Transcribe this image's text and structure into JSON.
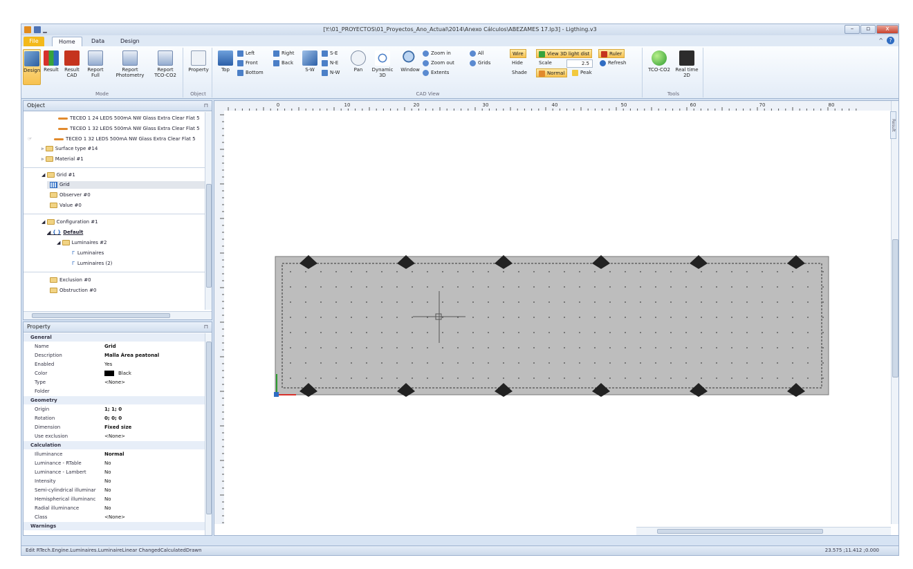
{
  "window": {
    "title": "[Y:\\01_PROYECTOS\\01_Proyectos_Ano_Actual\\2014\\Anexo Cálculos\\ABEZAMES 17.lp3] - Ligthing.v3",
    "controls": [
      "–",
      "▫",
      "x"
    ]
  },
  "tabs": [
    {
      "label": "File"
    },
    {
      "label": "Home"
    },
    {
      "label": "Data"
    },
    {
      "label": "Design"
    }
  ],
  "ribbon": {
    "mode": {
      "group_label": "Mode",
      "buttons": [
        {
          "label": "Design",
          "icon": "design-icon"
        },
        {
          "label": "Result",
          "icon": "bar-chart-icon"
        },
        {
          "label": "Result CAD",
          "icon": "cad-icon"
        },
        {
          "label": "Report Full",
          "icon": "report-icon"
        },
        {
          "label": "Report Photometry",
          "icon": "report-icon"
        },
        {
          "label": "Report TCO-CO2",
          "icon": "report-icon"
        }
      ]
    },
    "object": {
      "group_label": "Object",
      "button": "Property"
    },
    "cadview": {
      "group_label": "CAD View",
      "top": "Top",
      "left": "Left",
      "right": "Right",
      "front": "Front",
      "back": "Back",
      "bottom": "Bottom",
      "sw": "S-W",
      "se": "S-E",
      "ne": "N-E",
      "nw": "N-W",
      "pan": "Pan",
      "dynamic": "Dynamic 3D",
      "window": "Window",
      "zoom_in": "Zoom in",
      "zoom_out": "Zoom out",
      "extents": "Extents",
      "all": "All",
      "grids": "Grids",
      "wire": "Wire",
      "hide": "Hide",
      "shade": "Shade",
      "view3d": "View 3D light dist",
      "scale_label": "Scale",
      "scale_value": "2.5",
      "normal": "Normal",
      "peak": "Peak",
      "ruler": "Ruler",
      "refresh": "Refresh"
    },
    "tools": {
      "group_label": "Tools",
      "tco": "TCO-CO2",
      "realtime": "Real time 2D"
    }
  },
  "object_panel": {
    "title": "Object",
    "nodes": [
      {
        "label": "TECEO 1 24 LEDS 500mA NW Glass Extra Clear Flat 5",
        "kind": "lum"
      },
      {
        "label": "TECEO 1 32 LEDS 500mA NW Glass Extra Clear Flat 5",
        "kind": "lum"
      },
      {
        "label": "TECEO 1 32 LEDS 500mA NW Glass Extra Clear Flat 5",
        "kind": "lum"
      },
      {
        "label": "Surface type #14",
        "kind": "folder"
      },
      {
        "label": "Material #1",
        "kind": "folder"
      },
      {
        "label": "Grid #1",
        "kind": "folder"
      },
      {
        "label": "Grid",
        "kind": "grid"
      },
      {
        "label": "Observer #0",
        "kind": "folder"
      },
      {
        "label": "Value #0",
        "kind": "folder"
      },
      {
        "label": "Configuration #1",
        "kind": "folder"
      },
      {
        "label": "Default",
        "kind": "config"
      },
      {
        "label": "Luminaires #2",
        "kind": "folder"
      },
      {
        "label": "Luminaires",
        "kind": "item"
      },
      {
        "label": "Luminaires (2)",
        "kind": "item"
      },
      {
        "label": "Exclusion #0",
        "kind": "folder"
      },
      {
        "label": "Obstruction #0",
        "kind": "folder"
      }
    ]
  },
  "property_panel": {
    "title": "Property",
    "rows": [
      {
        "key": "General",
        "value": "",
        "cat": true
      },
      {
        "key": "Name",
        "value": "Grid"
      },
      {
        "key": "Description",
        "value": "Malla Área peatonal"
      },
      {
        "key": "Enabled",
        "value": "Yes"
      },
      {
        "key": "Color",
        "value": "Black"
      },
      {
        "key": "Type",
        "value": "<None>"
      },
      {
        "key": "Folder",
        "value": ""
      },
      {
        "key": "Geometry",
        "value": "",
        "cat": true
      },
      {
        "key": "Origin",
        "value": "1; 1; 0"
      },
      {
        "key": "Rotation",
        "value": "0; 0; 0"
      },
      {
        "key": "Dimension",
        "value": "Fixed size"
      },
      {
        "key": "Use exclusion",
        "value": "<None>"
      },
      {
        "key": "Calculation",
        "value": "",
        "cat": true
      },
      {
        "key": "Illuminance",
        "value": "Normal"
      },
      {
        "key": "Luminance - RTable",
        "value": "No"
      },
      {
        "key": "Luminance - Lambert",
        "value": "No"
      },
      {
        "key": "Intensity",
        "value": "No"
      },
      {
        "key": "Semi-cylindrical illuminar",
        "value": "No"
      },
      {
        "key": "Hemispherical illuminanc",
        "value": "No"
      },
      {
        "key": "Radial illuminance",
        "value": "No"
      },
      {
        "key": "Class",
        "value": "<None>"
      },
      {
        "key": "Warnings",
        "value": "",
        "cat": true
      }
    ]
  },
  "ruler": {
    "ticks": [
      "0",
      "10",
      "20",
      "30",
      "40",
      "50",
      "60",
      "70",
      "80"
    ]
  },
  "side_tab": "Result",
  "status": {
    "left": "Edit RTech.Engine.Luminaires.LuminaireLinear ChangedCalculatedDrawn",
    "right": "23.575 ;11.412 ;0.000"
  },
  "colors": {
    "accent": "#f3b91b",
    "chrome": "#d6e3f3",
    "grid_fill": "#bdbdbd"
  }
}
